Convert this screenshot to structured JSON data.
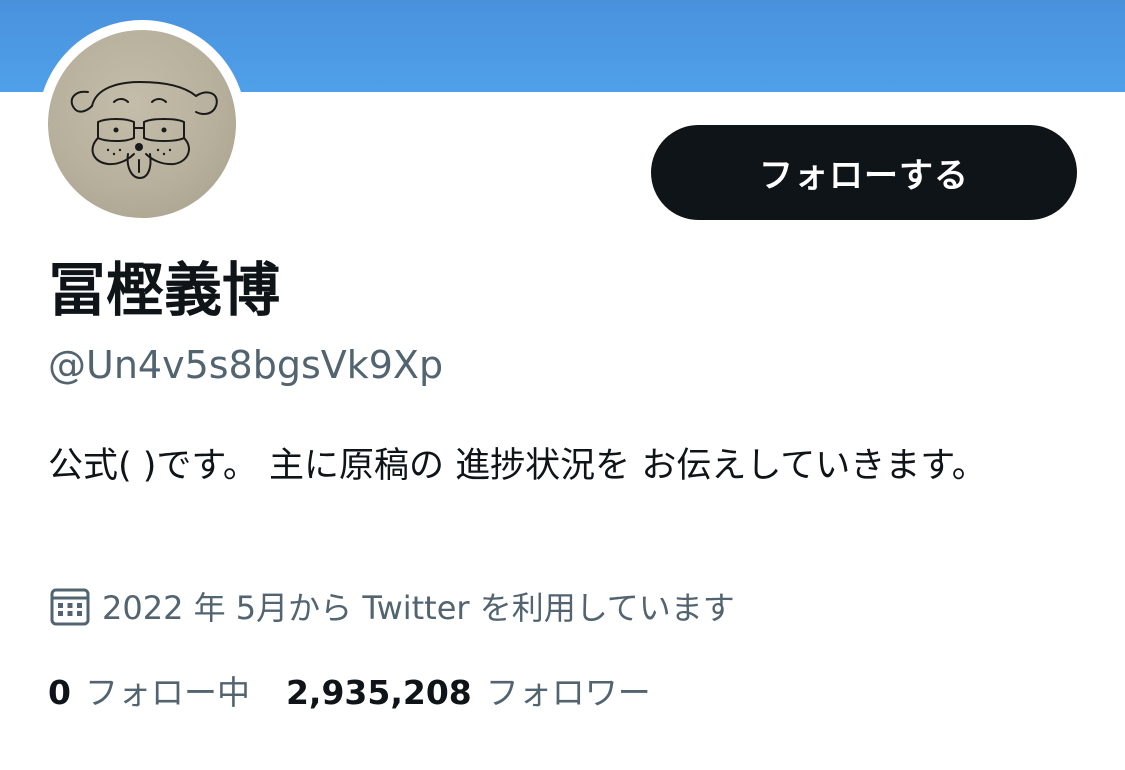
{
  "profile": {
    "display_name": "冨樫義博",
    "handle": "@Un4v5s8bgsVk9Xp",
    "bio": "公式( )です。 主に原稿の 進捗状況を お伝えしていきます。",
    "joined": "2022 年 5月から Twitter を利用しています",
    "follow_button_label": "フォローする"
  },
  "stats": {
    "following_count": "0",
    "following_label": "フォロー中",
    "followers_count": "2,935,208",
    "followers_label": "フォロワー"
  },
  "icons": {
    "avatar": "dog-face-drawing",
    "joined": "calendar-icon"
  },
  "colors": {
    "banner": "#4a97e4",
    "button_bg": "#0f1419",
    "secondary_text": "#536471"
  }
}
